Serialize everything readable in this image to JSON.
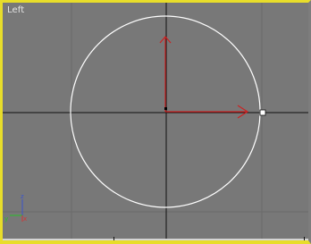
{
  "viewport": {
    "label": "Left",
    "view_name": "left-view",
    "active": true
  },
  "colors": {
    "background": "#787878",
    "grid_line": "#6a6a6a",
    "axis_line": "#111111",
    "active_border": "#e8dd2a",
    "circle": "#ffffff",
    "gizmo_y": "#cc2222",
    "gizmo_x": "#cc2222",
    "triad_x": "#d23535",
    "triad_y": "#28c028",
    "triad_z": "#3a55cc"
  },
  "icons": {
    "axis_triad": "xyz-axis-triad-icon",
    "move_gizmo_y": "gizmo-y-arrow-icon",
    "move_gizmo_x": "gizmo-x-arrow-icon",
    "grip": "vertex-grip-icon"
  }
}
